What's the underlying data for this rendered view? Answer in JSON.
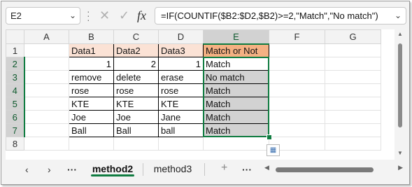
{
  "formula_bar": {
    "name_box": "E2",
    "cancel_glyph": "✕",
    "enter_glyph": "✓",
    "fx_label": "fx",
    "formula": "=IF(COUNTIF($B2:$D2,$B2)>=2,\"Match\",\"No match\")"
  },
  "columns": [
    "A",
    "B",
    "C",
    "D",
    "E",
    "F",
    "G"
  ],
  "rows": [
    {
      "num": "1",
      "cells": [
        "",
        "Data1",
        "Data2",
        "Data3",
        "Match or Not",
        "",
        ""
      ]
    },
    {
      "num": "2",
      "cells": [
        "",
        "1",
        "2",
        "1",
        "Match",
        "",
        ""
      ]
    },
    {
      "num": "3",
      "cells": [
        "",
        "remove",
        "delete",
        "erase",
        "No match",
        "",
        ""
      ]
    },
    {
      "num": "4",
      "cells": [
        "",
        "rose",
        "rose",
        "rose",
        "Match",
        "",
        ""
      ]
    },
    {
      "num": "5",
      "cells": [
        "",
        "KTE",
        "KTE",
        "KTE",
        "Match",
        "",
        ""
      ]
    },
    {
      "num": "6",
      "cells": [
        "",
        "Joe",
        "Joe",
        "Jane",
        "Match",
        "",
        ""
      ]
    },
    {
      "num": "7",
      "cells": [
        "",
        "Ball",
        "Ball",
        "ball",
        "Match",
        "",
        ""
      ]
    },
    {
      "num": "8",
      "cells": [
        "",
        "",
        "",
        "",
        "",
        "",
        ""
      ]
    }
  ],
  "header_colors": {
    "data_header": "#fbe2d5",
    "result_header": "#f4b183"
  },
  "selection_color": "#107c41",
  "sheet_tabs": {
    "prev_glyph": "‹",
    "next_glyph": "›",
    "more_glyph": "···",
    "tabs": [
      {
        "label": "method2",
        "active": true
      },
      {
        "label": "method3",
        "active": false
      }
    ],
    "add_glyph": "+"
  }
}
